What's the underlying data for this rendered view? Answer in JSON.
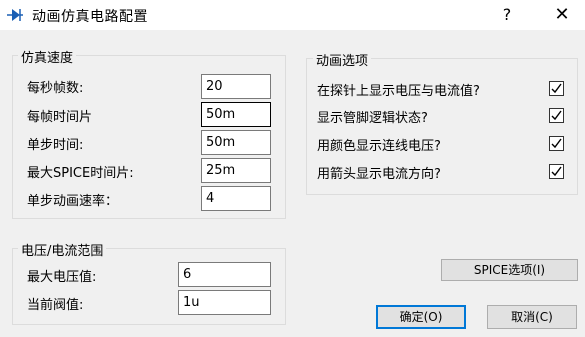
{
  "window": {
    "title": "动画仿真电路配置",
    "help_label": "?",
    "close_label": "✕",
    "icon": "circuit-app-icon"
  },
  "simulation_speed": {
    "title": "仿真速度",
    "fields": [
      {
        "label": "每秒帧数:",
        "value": "20"
      },
      {
        "label": "每帧时间片",
        "value": "50m"
      },
      {
        "label": "单步时间:",
        "value": "50m"
      },
      {
        "label": "最大SPICE时间片:",
        "value": "25m"
      },
      {
        "label": "单步动画速率：",
        "value": "4"
      }
    ]
  },
  "voltage_current_range": {
    "title": "电压/电流范围",
    "fields": [
      {
        "label": "最大电压值:",
        "value": "6"
      },
      {
        "label": "当前阀值:",
        "value": "1u"
      }
    ]
  },
  "animation_options": {
    "title": "动画选项",
    "options": [
      {
        "label": "在探针上显示电压与电流值?",
        "checked": true
      },
      {
        "label": "显示管脚逻辑状态?",
        "checked": true
      },
      {
        "label": "用颜色显示连线电压?",
        "checked": true
      },
      {
        "label": "用箭头显示电流方向?",
        "checked": true
      }
    ]
  },
  "buttons": {
    "spice_options": "SPICE选项(I)",
    "ok": "确定(O)",
    "cancel": "取消(C)"
  },
  "colors": {
    "focus_border": "#000000",
    "default_button_border": "#0078d7",
    "window_background": "#f0f0f0",
    "titlebar_background": "#ffffff"
  }
}
